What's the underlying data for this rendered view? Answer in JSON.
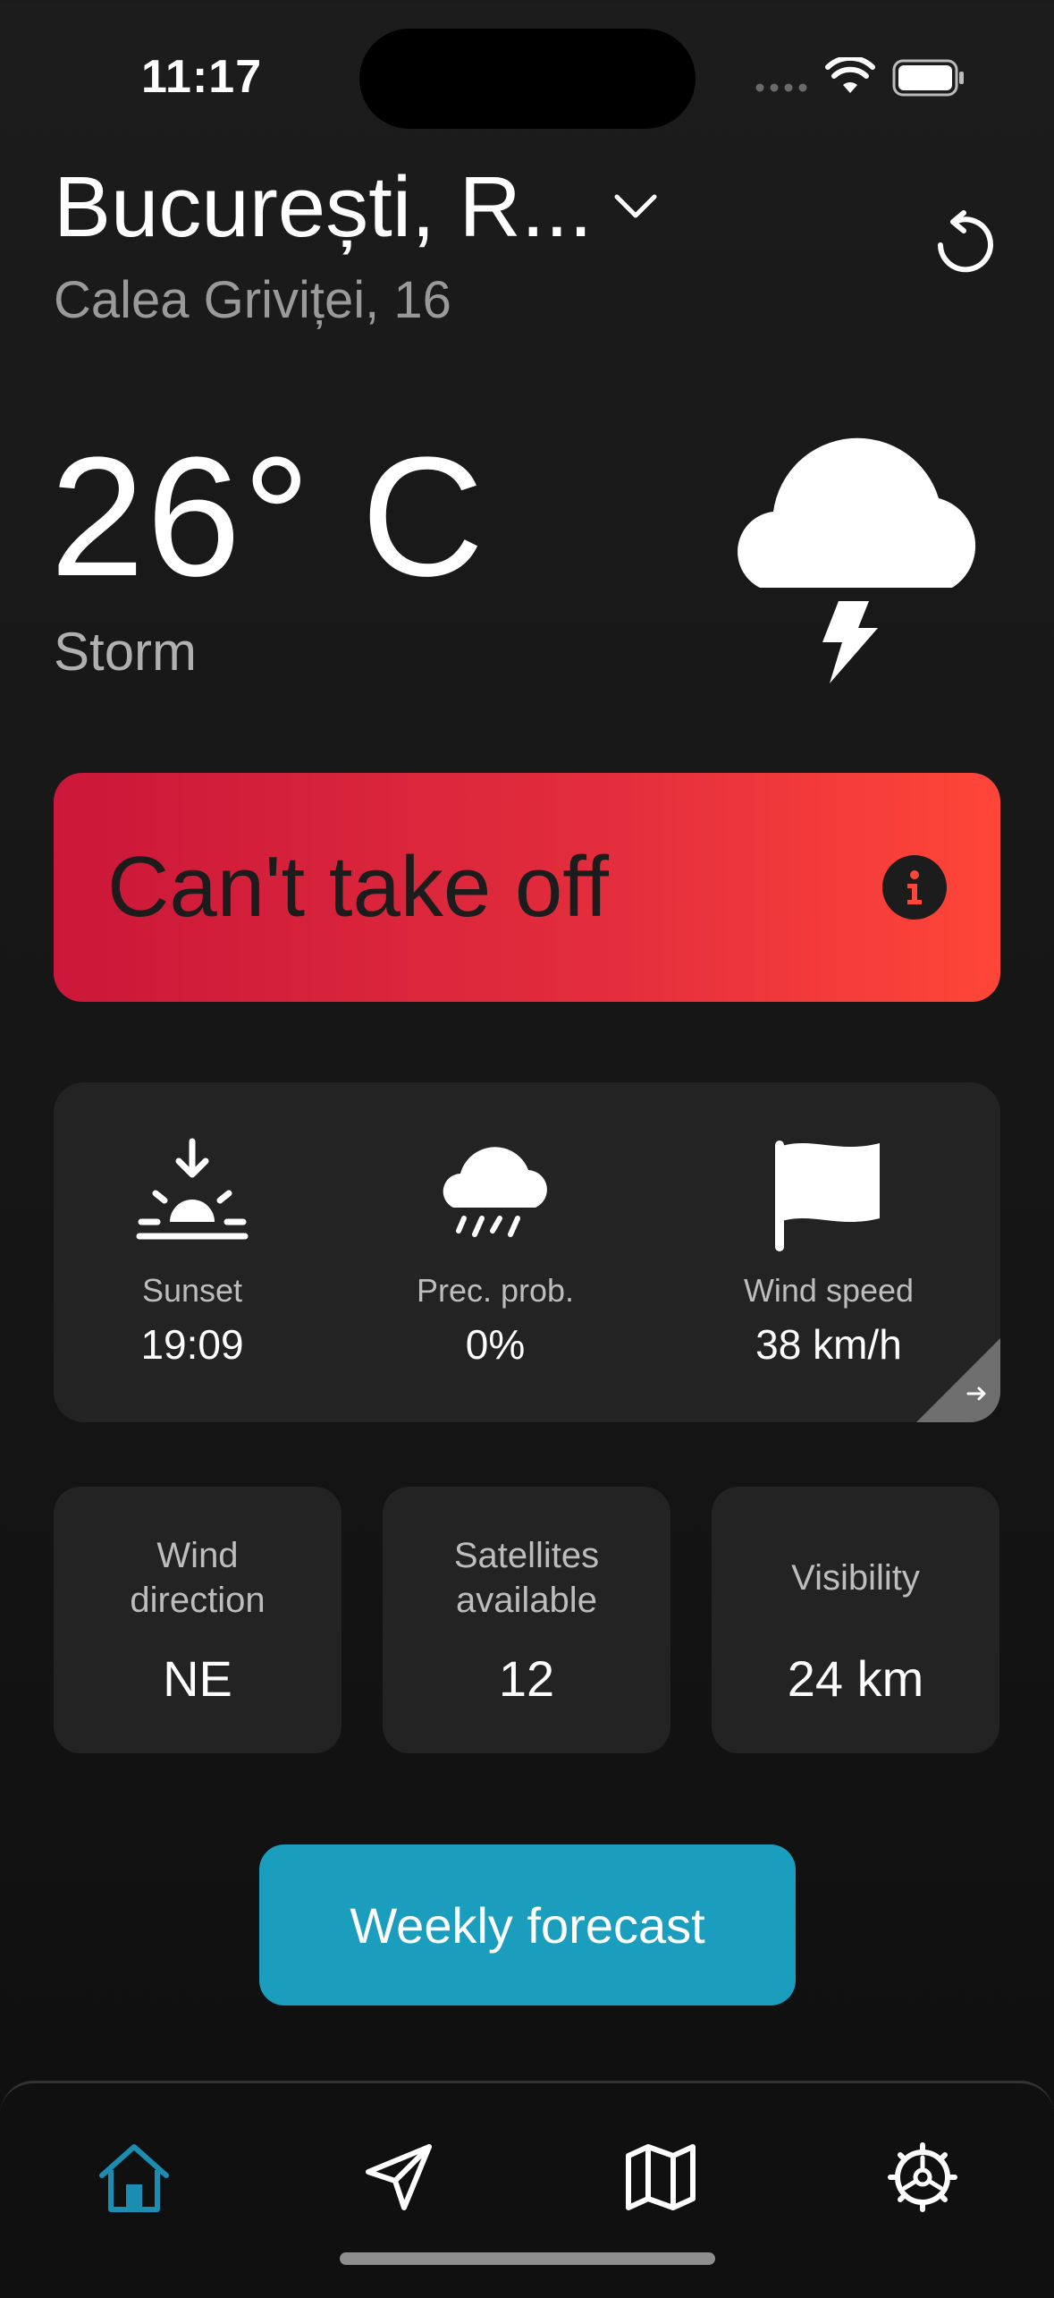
{
  "status_bar": {
    "time": "11:17"
  },
  "location": {
    "city": "București, R...",
    "street": "Calea Griviței, 16"
  },
  "weather": {
    "temperature": "26° C",
    "condition": "Storm",
    "icon": "cloud-lightning-icon"
  },
  "alert": {
    "text": "Can't take off",
    "gradient": [
      "#cb1739",
      "#ff4638"
    ]
  },
  "stats": [
    {
      "label": "Sunset",
      "value": "19:09",
      "icon": "sunset-icon"
    },
    {
      "label": "Prec. prob.",
      "value": "0%",
      "icon": "rain-cloud-icon"
    },
    {
      "label": "Wind speed",
      "value": "38 km/h",
      "icon": "flag-icon"
    }
  ],
  "tiles": [
    {
      "label": "Wind direction",
      "value": "NE"
    },
    {
      "label": "Satellites available",
      "value": "12"
    },
    {
      "label": "Visibility",
      "value": "24 km"
    }
  ],
  "weekly_button": {
    "label": "Weekly forecast",
    "color": "#1b9dbd"
  },
  "tabs": [
    {
      "name": "home",
      "icon": "home-icon",
      "active": true
    },
    {
      "name": "navigate",
      "icon": "navigation-arrow-icon",
      "active": false
    },
    {
      "name": "map",
      "icon": "map-icon",
      "active": false
    },
    {
      "name": "settings",
      "icon": "gear-icon",
      "active": false
    }
  ],
  "colors": {
    "accent": "#1b9dbd",
    "background": "#181818",
    "card": "#232323"
  }
}
